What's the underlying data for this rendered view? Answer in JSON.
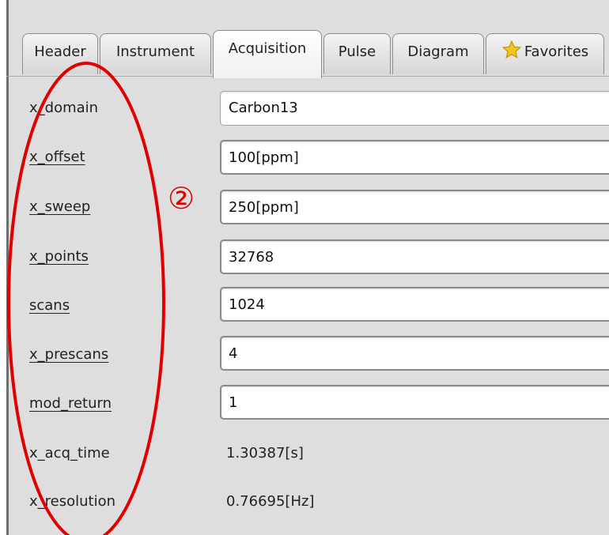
{
  "tabs": [
    {
      "label": "Header"
    },
    {
      "label": "Instrument"
    },
    {
      "label": "Acquisition",
      "active": true
    },
    {
      "label": "Pulse"
    },
    {
      "label": "Diagram"
    },
    {
      "label": "Favorites",
      "icon": "star-icon"
    }
  ],
  "fields": [
    {
      "label": "x_domain",
      "value": "Carbon13"
    },
    {
      "label": "x_offset",
      "value": "100[ppm]"
    },
    {
      "label": "x_sweep",
      "value": "250[ppm]"
    },
    {
      "label": "x_points",
      "value": "32768"
    },
    {
      "label": "scans",
      "value": "1024"
    },
    {
      "label": "x_prescans",
      "value": "4"
    },
    {
      "label": "mod_return",
      "value": "1"
    }
  ],
  "readonly": [
    {
      "label": "x_acq_time",
      "value": "1.30387[s]"
    },
    {
      "label": "x_resolution",
      "value": "0.76695[Hz]"
    }
  ],
  "annotation": {
    "marker": "②",
    "color": "#e00000"
  },
  "colors": {
    "panel": "#dedede",
    "annotation_red": "#e00000",
    "star_fill": "#f5c518"
  }
}
